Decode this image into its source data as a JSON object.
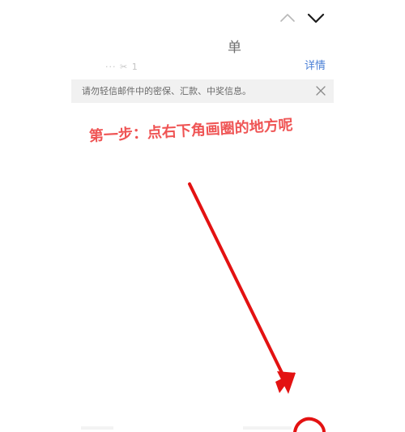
{
  "header": {
    "title": "单",
    "meta": "··· ✂ 1",
    "details_label": "详情"
  },
  "warning": {
    "text": "请勿轻信邮件中的密保、汇款、中奖信息。"
  },
  "annotation": {
    "text": "第一步：点右下角画圈的地方呢"
  },
  "colors": {
    "annotation": "#ef5454",
    "arrow": "#e31212",
    "link": "#4a7fd6",
    "warning_bg": "#f1f1f1"
  },
  "icons": {
    "previous": "chevron-up-icon",
    "next": "chevron-down-icon",
    "close": "close-icon",
    "annotation_arrow": "arrow-icon"
  }
}
